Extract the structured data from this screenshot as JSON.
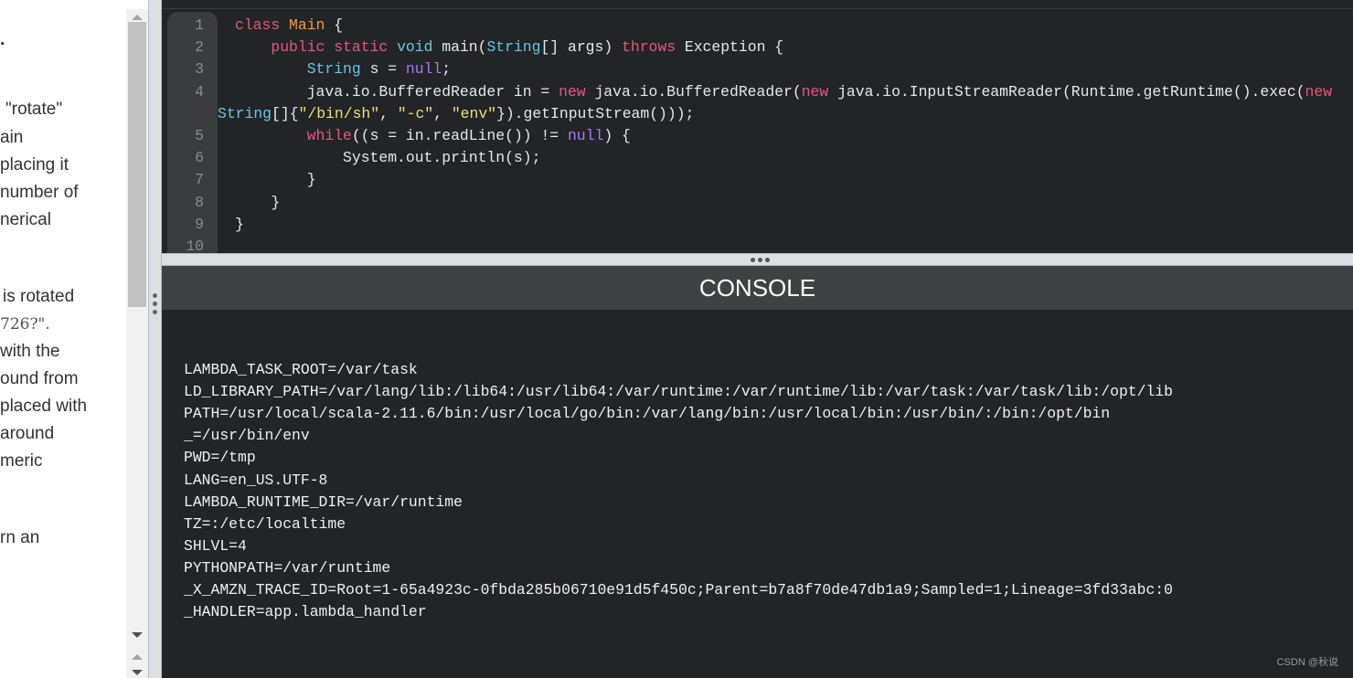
{
  "description_panel": {
    "lines": [
      "",
      "\"rotate\"",
      "ain",
      "placing it",
      "number of",
      "nerical",
      "is rotated",
      "726?\".",
      "with the",
      "ound from",
      "placed with",
      "around",
      "meric",
      "rn an"
    ]
  },
  "editor": {
    "lines": [
      {
        "num": "1",
        "tokens": [
          [
            "class ",
            "kw"
          ],
          [
            "Main",
            "cls"
          ],
          [
            " {",
            "pl"
          ]
        ]
      },
      {
        "num": "2",
        "tokens": [
          [
            "    ",
            "pl"
          ],
          [
            "public static ",
            "kw"
          ],
          [
            "void ",
            "ty"
          ],
          [
            "main(",
            "pl"
          ],
          [
            "String",
            "ty"
          ],
          [
            "[] args) ",
            "pl"
          ],
          [
            "throws ",
            "kw"
          ],
          [
            "Exception {",
            "pl"
          ]
        ]
      },
      {
        "num": "3",
        "tokens": [
          [
            "        ",
            "pl"
          ],
          [
            "String ",
            "ty"
          ],
          [
            "s = ",
            "pl"
          ],
          [
            "null",
            "nu"
          ],
          [
            ";",
            "pl"
          ]
        ]
      },
      {
        "num": "4",
        "tokens": [
          [
            "        java.io.BufferedReader in = ",
            "pl"
          ],
          [
            "new ",
            "kw"
          ],
          [
            "java.io.BufferedReader(",
            "pl"
          ],
          [
            "new ",
            "kw"
          ],
          [
            "java.io.InputStreamReader(Runtime.getRuntime().exec(",
            "pl"
          ],
          [
            "new",
            "kw"
          ]
        ]
      },
      {
        "num": "",
        "wrap": true,
        "tokens": [
          [
            "String",
            "ty"
          ],
          [
            "[]{",
            "pl"
          ],
          [
            "\"/bin/sh\"",
            "st"
          ],
          [
            ", ",
            "pl"
          ],
          [
            "\"-c\"",
            "st"
          ],
          [
            ", ",
            "pl"
          ],
          [
            "\"env\"",
            "st"
          ],
          [
            "}).getInputStream()));",
            "pl"
          ]
        ]
      },
      {
        "num": "5",
        "tokens": [
          [
            "        ",
            "pl"
          ],
          [
            "while",
            "kw"
          ],
          [
            "((s = in.readLine()) != ",
            "pl"
          ],
          [
            "null",
            "nu"
          ],
          [
            ") {",
            "pl"
          ]
        ]
      },
      {
        "num": "6",
        "tokens": [
          [
            "            System.out.println(s);",
            "pl"
          ]
        ]
      },
      {
        "num": "7",
        "tokens": [
          [
            "        }",
            "pl"
          ]
        ]
      },
      {
        "num": "8",
        "tokens": [
          [
            "    }",
            "pl"
          ]
        ]
      },
      {
        "num": "9",
        "tokens": [
          [
            "}",
            "pl"
          ]
        ]
      },
      {
        "num": "10",
        "tokens": []
      }
    ]
  },
  "console": {
    "title": "CONSOLE",
    "output": [
      "LAMBDA_TASK_ROOT=/var/task",
      "LD_LIBRARY_PATH=/var/lang/lib:/lib64:/usr/lib64:/var/runtime:/var/runtime/lib:/var/task:/var/task/lib:/opt/lib",
      "PATH=/usr/local/scala-2.11.6/bin:/usr/local/go/bin:/var/lang/bin:/usr/local/bin:/usr/bin/:/bin:/opt/bin",
      "_=/usr/bin/env",
      "PWD=/tmp",
      "LANG=en_US.UTF-8",
      "LAMBDA_RUNTIME_DIR=/var/runtime",
      "TZ=:/etc/localtime",
      "SHLVL=4",
      "PYTHONPATH=/var/runtime",
      "_X_AMZN_TRACE_ID=Root=1-65a4923c-0fbda285b06710e91d5f450c;Parent=b7a8f70de47db1a9;Sampled=1;Lineage=3fd33abc:0",
      "_HANDLER=app.lambda_handler"
    ]
  },
  "watermark": "CSDN @秋说",
  "colors": {
    "keyword": "#e05a7e",
    "class": "#f09a3e",
    "type": "#67c6e6",
    "null": "#a57cf0",
    "string": "#ebe07a",
    "editor_bg": "#232427",
    "console_header_bg": "#404143"
  }
}
